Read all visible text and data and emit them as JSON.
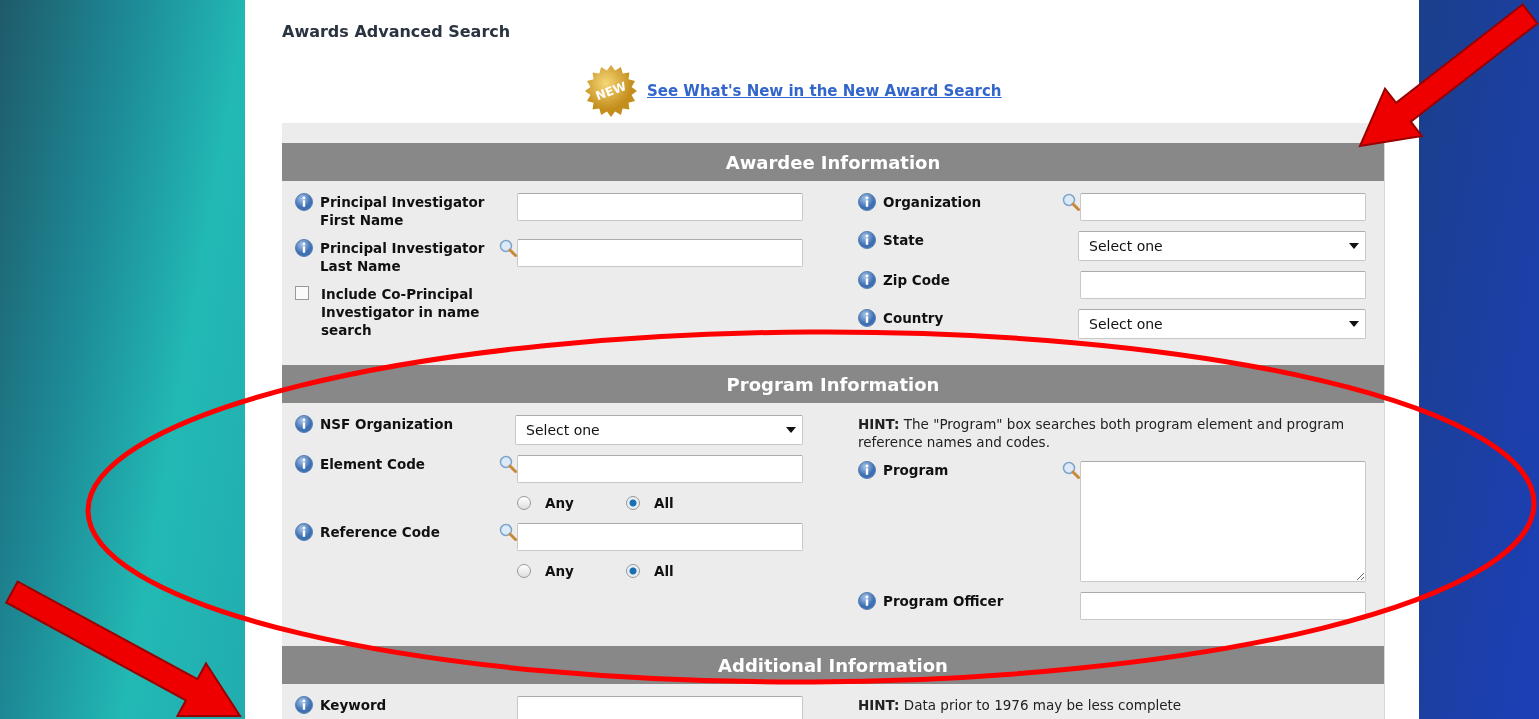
{
  "page_title": "Awards Advanced Search",
  "new_badge": "NEW",
  "whats_new_link": "See What's New in the New Award Search",
  "sections": [
    {
      "title": "Awardee Information",
      "left": [
        {
          "kind": "text",
          "label": "Principal Investigator First Name",
          "info": true,
          "search": false
        },
        {
          "kind": "text",
          "label": "Principal Investigator Last Name",
          "info": true,
          "search": true
        },
        {
          "kind": "checkbox",
          "label": "Include Co-Principal Investigator in name search",
          "checked": false
        }
      ],
      "right": [
        {
          "kind": "text",
          "label": "Organization",
          "info": true,
          "search": true
        },
        {
          "kind": "select",
          "label": "State",
          "info": true,
          "search": false,
          "value": "Select one"
        },
        {
          "kind": "text",
          "label": "Zip Code",
          "info": true,
          "search": false
        },
        {
          "kind": "select",
          "label": "Country",
          "info": true,
          "search": false,
          "value": "Select one"
        }
      ]
    },
    {
      "title": "Program Information",
      "left": [
        {
          "kind": "select",
          "label": "NSF Organization",
          "info": true,
          "search": false,
          "value": "Select one"
        },
        {
          "kind": "text",
          "label": "Element Code",
          "info": true,
          "search": true
        },
        {
          "kind": "radio",
          "options": [
            {
              "label": "Any",
              "selected": false
            },
            {
              "label": "All",
              "selected": true
            }
          ]
        },
        {
          "kind": "text",
          "label": "Reference Code",
          "info": true,
          "search": true
        },
        {
          "kind": "radio",
          "options": [
            {
              "label": "Any",
              "selected": false
            },
            {
              "label": "All",
              "selected": true
            }
          ]
        }
      ],
      "right": [
        {
          "kind": "hint",
          "text": "**HINT:** The \"Program\" box searches both program element and program reference names and codes."
        },
        {
          "kind": "textarea",
          "label": "Program",
          "info": true,
          "search": true
        },
        {
          "kind": "text",
          "label": "Program Officer",
          "info": true,
          "search": false
        }
      ]
    },
    {
      "title": "Additional Information",
      "left": [
        {
          "kind": "text",
          "label": "Keyword",
          "info": true,
          "search": false
        }
      ],
      "right": [
        {
          "kind": "hint",
          "text": "**HINT:** Data prior to 1976 may be less complete"
        }
      ]
    }
  ]
}
